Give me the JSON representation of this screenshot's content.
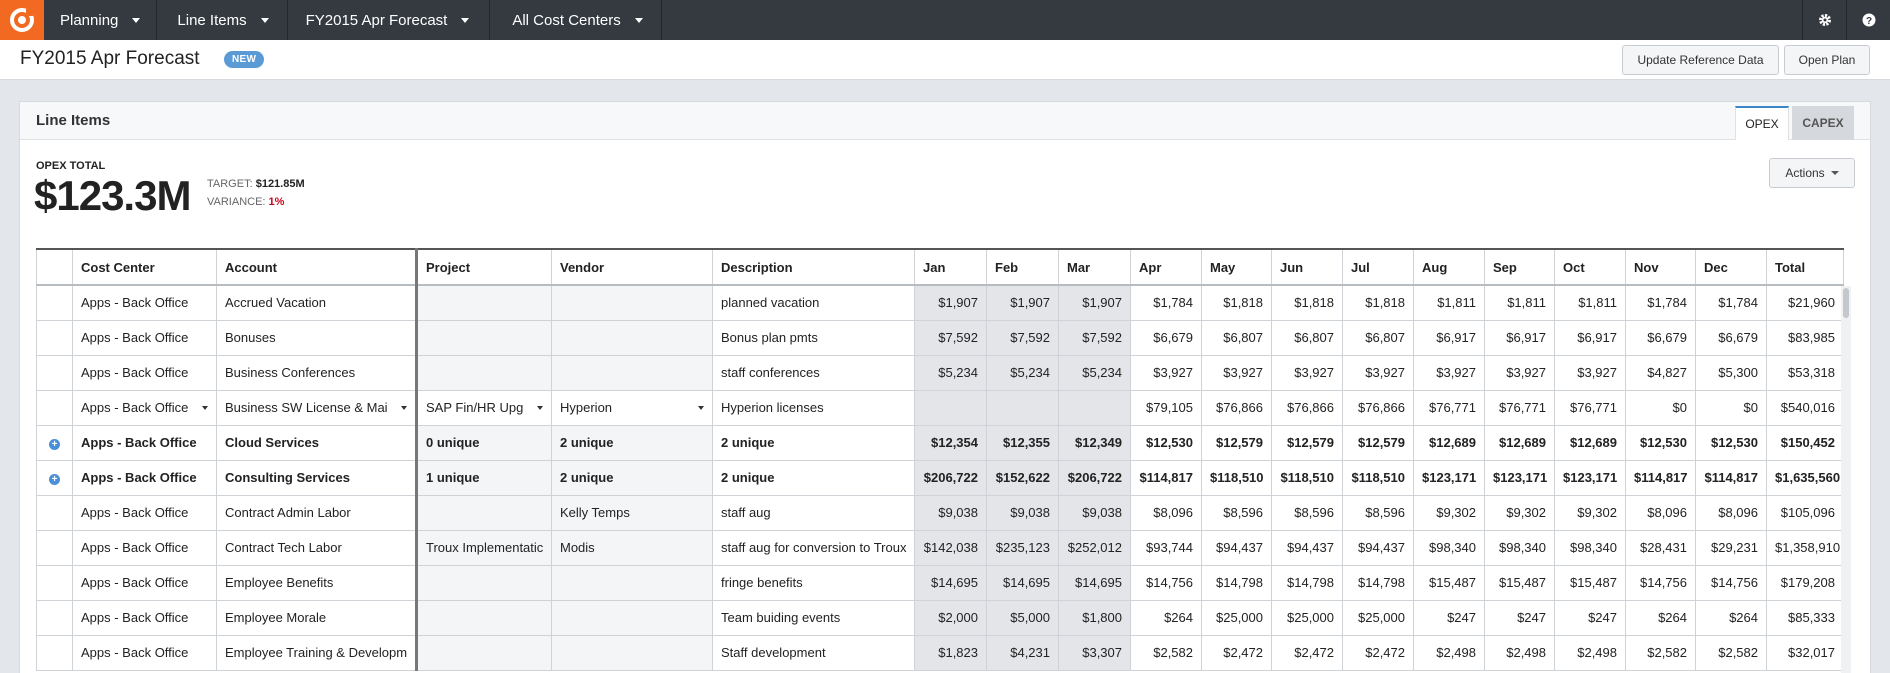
{
  "nav": {
    "items": [
      {
        "label": "Planning"
      },
      {
        "label": "Line Items"
      },
      {
        "label": "FY2015 Apr Forecast"
      },
      {
        "label": "All Cost Centers"
      }
    ],
    "settings_icon": "gear-icon",
    "help_icon": "help-icon"
  },
  "header": {
    "title": "FY2015 Apr Forecast",
    "badge": "NEW",
    "update_button": "Update Reference Data",
    "open_button": "Open Plan"
  },
  "panel": {
    "title": "Line Items",
    "tabs": [
      "OPEX",
      "CAPEX"
    ],
    "active_tab": "OPEX",
    "total_label": "OPEX TOTAL",
    "total_value": "$123.3M",
    "target_label": "TARGET:",
    "target_value": "$121.85M",
    "variance_label": "VARIANCE:",
    "variance_value": "1%",
    "actions_button": "Actions"
  },
  "table": {
    "columns": [
      "Cost Center",
      "Account",
      "Project",
      "Vendor",
      "Description",
      "Jan",
      "Feb",
      "Mar",
      "Apr",
      "May",
      "Jun",
      "Jul",
      "Aug",
      "Sep",
      "Oct",
      "Nov",
      "Dec",
      "Total"
    ],
    "rows": [
      {
        "cells": [
          "Apps - Back Office",
          "Accrued Vacation",
          "",
          "",
          "planned vacation",
          "$1,907",
          "$1,907",
          "$1,907",
          "$1,784",
          "$1,818",
          "$1,818",
          "$1,818",
          "$1,811",
          "$1,811",
          "$1,811",
          "$1,784",
          "$1,784",
          "$21,960"
        ]
      },
      {
        "cells": [
          "Apps - Back Office",
          "Bonuses",
          "",
          "",
          "Bonus plan pmts",
          "$7,592",
          "$7,592",
          "$7,592",
          "$6,679",
          "$6,807",
          "$6,807",
          "$6,807",
          "$6,917",
          "$6,917",
          "$6,917",
          "$6,679",
          "$6,679",
          "$83,985"
        ]
      },
      {
        "cells": [
          "Apps - Back Office",
          "Business Conferences",
          "",
          "",
          "staff conferences",
          "$5,234",
          "$5,234",
          "$5,234",
          "$3,927",
          "$3,927",
          "$3,927",
          "$3,927",
          "$3,927",
          "$3,927",
          "$3,927",
          "$4,827",
          "$5,300",
          "$53,318"
        ]
      },
      {
        "cells": [
          "Apps - Back Office",
          "Business SW License & Mai",
          "SAP Fin/HR Upg",
          "Hyperion",
          "Hyperion licenses",
          "",
          "",
          "",
          "$79,105",
          "$76,866",
          "$76,866",
          "$76,866",
          "$76,771",
          "$76,771",
          "$76,771",
          "$0",
          "$0",
          "$540,016"
        ]
      },
      {
        "cells": [
          "Apps - Back Office",
          "Cloud Services",
          "0 unique",
          "2 unique",
          "2 unique",
          "$12,354",
          "$12,355",
          "$12,349",
          "$12,530",
          "$12,579",
          "$12,579",
          "$12,579",
          "$12,689",
          "$12,689",
          "$12,689",
          "$12,530",
          "$12,530",
          "$150,452"
        ]
      },
      {
        "cells": [
          "Apps - Back Office",
          "Consulting Services",
          "1 unique",
          "2 unique",
          "2 unique",
          "$206,722",
          "$152,622",
          "$206,722",
          "$114,817",
          "$118,510",
          "$118,510",
          "$118,510",
          "$123,171",
          "$123,171",
          "$123,171",
          "$114,817",
          "$114,817",
          "$1,635,560"
        ]
      },
      {
        "cells": [
          "Apps - Back Office",
          "Contract Admin Labor",
          "",
          "Kelly Temps",
          "staff aug",
          "$9,038",
          "$9,038",
          "$9,038",
          "$8,096",
          "$8,596",
          "$8,596",
          "$8,596",
          "$9,302",
          "$9,302",
          "$9,302",
          "$8,096",
          "$8,096",
          "$105,096"
        ]
      },
      {
        "cells": [
          "Apps - Back Office",
          "Contract Tech Labor",
          "Troux Implementatic",
          "Modis",
          "staff aug for conversion to Troux",
          "$142,038",
          "$235,123",
          "$252,012",
          "$93,744",
          "$94,437",
          "$94,437",
          "$94,437",
          "$98,340",
          "$98,340",
          "$98,340",
          "$28,431",
          "$29,231",
          "$1,358,910"
        ]
      },
      {
        "cells": [
          "Apps - Back Office",
          "Employee Benefits",
          "",
          "",
          "fringe benefits",
          "$14,695",
          "$14,695",
          "$14,695",
          "$14,756",
          "$14,798",
          "$14,798",
          "$14,798",
          "$15,487",
          "$15,487",
          "$15,487",
          "$14,756",
          "$14,756",
          "$179,208"
        ]
      },
      {
        "cells": [
          "Apps - Back Office",
          "Employee Morale",
          "",
          "",
          "Team buiding events",
          "$2,000",
          "$5,000",
          "$1,800",
          "$264",
          "$25,000",
          "$25,000",
          "$25,000",
          "$247",
          "$247",
          "$247",
          "$264",
          "$264",
          "$85,333"
        ]
      },
      {
        "cells": [
          "Apps - Back Office",
          "Employee Training & Developm",
          "",
          "",
          "Staff development",
          "$1,823",
          "$4,231",
          "$3,307",
          "$2,582",
          "$2,472",
          "$2,472",
          "$2,472",
          "$2,498",
          "$2,498",
          "$2,498",
          "$2,582",
          "$2,582",
          "$32,017"
        ]
      }
    ]
  }
}
